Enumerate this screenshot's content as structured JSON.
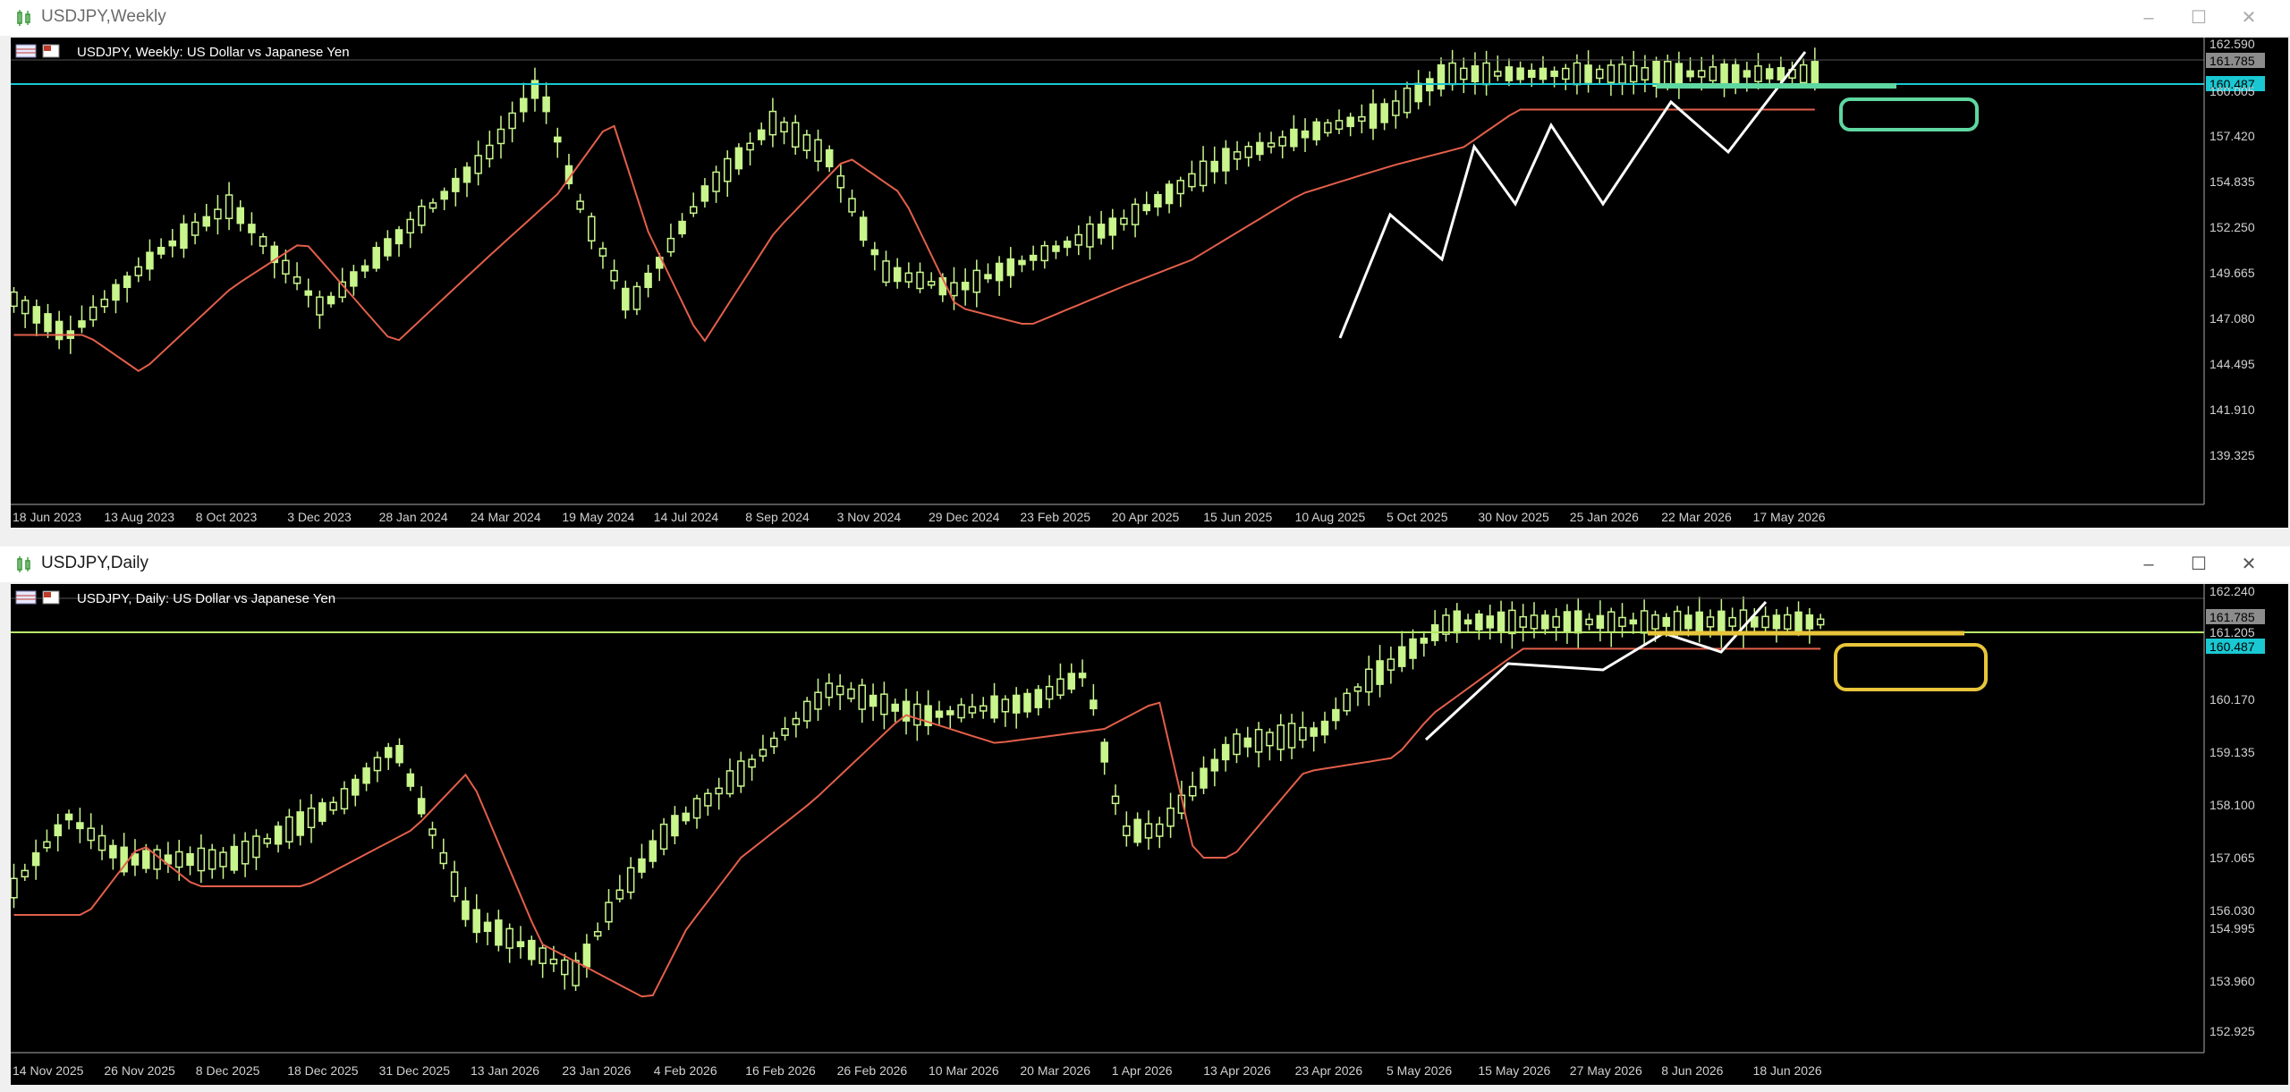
{
  "weekly": {
    "window_title": "USDJPY,Weekly",
    "chart_label": "USDJPY, Weekly:  US Dollar vs Japanese Yen",
    "price_levels": [
      "162.590",
      "161.785",
      "160.487",
      "160.005",
      "157.420",
      "154.835",
      "152.250",
      "149.665",
      "147.080",
      "144.495",
      "141.910",
      "139.325"
    ],
    "current_price": "161.785",
    "hline_price": "160.487",
    "dates": [
      "18 Jun 2023",
      "13 Aug 2023",
      "8 Oct 2023",
      "3 Dec 2023",
      "28 Jan 2024",
      "24 Mar 2024",
      "19 May 2024",
      "14 Jul 2024",
      "8 Sep 2024",
      "3 Nov 2024",
      "29 Dec 2024",
      "23 Feb 2025",
      "20 Apr 2025",
      "15 Jun 2025",
      "10 Aug 2025",
      "5 Oct 2025",
      "30 Nov 2025",
      "25 Jan 2026",
      "22 Mar 2026",
      "17 May 2026"
    ],
    "annotation_color": "#5fd7a0"
  },
  "daily": {
    "window_title": "USDJPY,Daily",
    "chart_label": "USDJPY, Daily:  US Dollar vs Japanese Yen",
    "price_levels": [
      "162.240",
      "161.785",
      "161.205",
      "160.487",
      "160.170",
      "159.135",
      "158.100",
      "157.065",
      "156.030",
      "154.995",
      "153.960",
      "152.925"
    ],
    "current_price": "161.785",
    "hline_price": "160.487",
    "dates": [
      "14 Nov 2025",
      "26 Nov 2025",
      "8 Dec 2025",
      "18 Dec 2025",
      "31 Dec 2025",
      "13 Jan 2026",
      "23 Jan 2026",
      "4 Feb 2026",
      "16 Feb 2026",
      "26 Feb 2026",
      "10 Mar 2026",
      "20 Mar 2026",
      "1 Apr 2026",
      "13 Apr 2026",
      "23 Apr 2026",
      "5 May 2026",
      "15 May 2026",
      "27 May 2026",
      "8 Jun 2026",
      "18 Jun 2026"
    ],
    "annotation_color": "#e8c53a"
  },
  "colors": {
    "candle": "#c8f58c",
    "ma": "#e35f4a",
    "hline_weekly": "#19c8d2",
    "hline_daily": "#b6e86a",
    "bg": "#000000",
    "grid_text": "#d0d0d0"
  }
}
